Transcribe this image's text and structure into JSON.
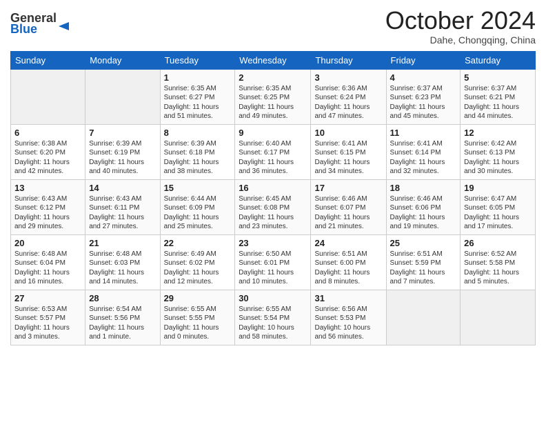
{
  "header": {
    "logo_general": "General",
    "logo_blue": "Blue",
    "month": "October 2024",
    "location": "Dahe, Chongqing, China"
  },
  "weekdays": [
    "Sunday",
    "Monday",
    "Tuesday",
    "Wednesday",
    "Thursday",
    "Friday",
    "Saturday"
  ],
  "weeks": [
    [
      {
        "day": "",
        "info": ""
      },
      {
        "day": "",
        "info": ""
      },
      {
        "day": "1",
        "info": "Sunrise: 6:35 AM\nSunset: 6:27 PM\nDaylight: 11 hours and 51 minutes."
      },
      {
        "day": "2",
        "info": "Sunrise: 6:35 AM\nSunset: 6:25 PM\nDaylight: 11 hours and 49 minutes."
      },
      {
        "day": "3",
        "info": "Sunrise: 6:36 AM\nSunset: 6:24 PM\nDaylight: 11 hours and 47 minutes."
      },
      {
        "day": "4",
        "info": "Sunrise: 6:37 AM\nSunset: 6:23 PM\nDaylight: 11 hours and 45 minutes."
      },
      {
        "day": "5",
        "info": "Sunrise: 6:37 AM\nSunset: 6:21 PM\nDaylight: 11 hours and 44 minutes."
      }
    ],
    [
      {
        "day": "6",
        "info": "Sunrise: 6:38 AM\nSunset: 6:20 PM\nDaylight: 11 hours and 42 minutes."
      },
      {
        "day": "7",
        "info": "Sunrise: 6:39 AM\nSunset: 6:19 PM\nDaylight: 11 hours and 40 minutes."
      },
      {
        "day": "8",
        "info": "Sunrise: 6:39 AM\nSunset: 6:18 PM\nDaylight: 11 hours and 38 minutes."
      },
      {
        "day": "9",
        "info": "Sunrise: 6:40 AM\nSunset: 6:17 PM\nDaylight: 11 hours and 36 minutes."
      },
      {
        "day": "10",
        "info": "Sunrise: 6:41 AM\nSunset: 6:15 PM\nDaylight: 11 hours and 34 minutes."
      },
      {
        "day": "11",
        "info": "Sunrise: 6:41 AM\nSunset: 6:14 PM\nDaylight: 11 hours and 32 minutes."
      },
      {
        "day": "12",
        "info": "Sunrise: 6:42 AM\nSunset: 6:13 PM\nDaylight: 11 hours and 30 minutes."
      }
    ],
    [
      {
        "day": "13",
        "info": "Sunrise: 6:43 AM\nSunset: 6:12 PM\nDaylight: 11 hours and 29 minutes."
      },
      {
        "day": "14",
        "info": "Sunrise: 6:43 AM\nSunset: 6:11 PM\nDaylight: 11 hours and 27 minutes."
      },
      {
        "day": "15",
        "info": "Sunrise: 6:44 AM\nSunset: 6:09 PM\nDaylight: 11 hours and 25 minutes."
      },
      {
        "day": "16",
        "info": "Sunrise: 6:45 AM\nSunset: 6:08 PM\nDaylight: 11 hours and 23 minutes."
      },
      {
        "day": "17",
        "info": "Sunrise: 6:46 AM\nSunset: 6:07 PM\nDaylight: 11 hours and 21 minutes."
      },
      {
        "day": "18",
        "info": "Sunrise: 6:46 AM\nSunset: 6:06 PM\nDaylight: 11 hours and 19 minutes."
      },
      {
        "day": "19",
        "info": "Sunrise: 6:47 AM\nSunset: 6:05 PM\nDaylight: 11 hours and 17 minutes."
      }
    ],
    [
      {
        "day": "20",
        "info": "Sunrise: 6:48 AM\nSunset: 6:04 PM\nDaylight: 11 hours and 16 minutes."
      },
      {
        "day": "21",
        "info": "Sunrise: 6:48 AM\nSunset: 6:03 PM\nDaylight: 11 hours and 14 minutes."
      },
      {
        "day": "22",
        "info": "Sunrise: 6:49 AM\nSunset: 6:02 PM\nDaylight: 11 hours and 12 minutes."
      },
      {
        "day": "23",
        "info": "Sunrise: 6:50 AM\nSunset: 6:01 PM\nDaylight: 11 hours and 10 minutes."
      },
      {
        "day": "24",
        "info": "Sunrise: 6:51 AM\nSunset: 6:00 PM\nDaylight: 11 hours and 8 minutes."
      },
      {
        "day": "25",
        "info": "Sunrise: 6:51 AM\nSunset: 5:59 PM\nDaylight: 11 hours and 7 minutes."
      },
      {
        "day": "26",
        "info": "Sunrise: 6:52 AM\nSunset: 5:58 PM\nDaylight: 11 hours and 5 minutes."
      }
    ],
    [
      {
        "day": "27",
        "info": "Sunrise: 6:53 AM\nSunset: 5:57 PM\nDaylight: 11 hours and 3 minutes."
      },
      {
        "day": "28",
        "info": "Sunrise: 6:54 AM\nSunset: 5:56 PM\nDaylight: 11 hours and 1 minute."
      },
      {
        "day": "29",
        "info": "Sunrise: 6:55 AM\nSunset: 5:55 PM\nDaylight: 11 hours and 0 minutes."
      },
      {
        "day": "30",
        "info": "Sunrise: 6:55 AM\nSunset: 5:54 PM\nDaylight: 10 hours and 58 minutes."
      },
      {
        "day": "31",
        "info": "Sunrise: 6:56 AM\nSunset: 5:53 PM\nDaylight: 10 hours and 56 minutes."
      },
      {
        "day": "",
        "info": ""
      },
      {
        "day": "",
        "info": ""
      }
    ]
  ]
}
